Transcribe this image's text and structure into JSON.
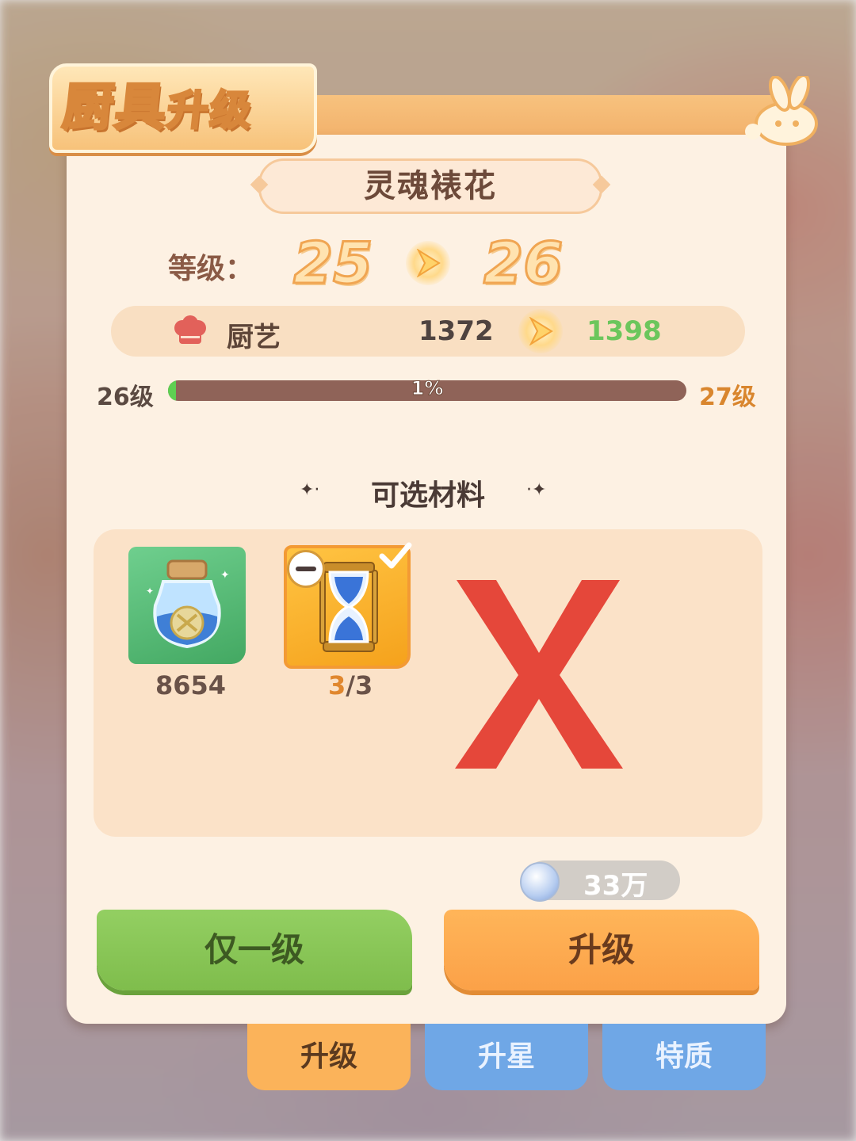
{
  "header": {
    "title_a": "厨具",
    "title_b": "升级"
  },
  "item_name": "灵魂裱花",
  "level": {
    "label": "等级：",
    "from": "25",
    "to": "26"
  },
  "stat": {
    "icon": "chef-hat-icon",
    "name": "厨艺",
    "from": "1372",
    "to": "1398"
  },
  "progress": {
    "left_label": "26级",
    "right_label": "27级",
    "text": "1%",
    "value": 0.01
  },
  "materials": {
    "title": "可选材料",
    "items": [
      {
        "icon": "magic-jar-icon",
        "count": "8654"
      },
      {
        "icon": "hourglass-icon",
        "count_current": "3",
        "count_sep": "/",
        "count_total": "3",
        "selected": true
      }
    ]
  },
  "cost": {
    "icon": "silver-coin-icon",
    "amount": "33万"
  },
  "buttons": {
    "one_level": "仅一级",
    "upgrade": "升级"
  },
  "tabs": [
    {
      "label": "升级",
      "active": true
    },
    {
      "label": "升星",
      "active": false
    },
    {
      "label": "特质",
      "active": false
    }
  ],
  "colors": {
    "accent_orange": "#fba148",
    "green_button": "#7fbd4c",
    "tab_blue": "#6fa7e6",
    "stat_up": "#6cc65c"
  }
}
